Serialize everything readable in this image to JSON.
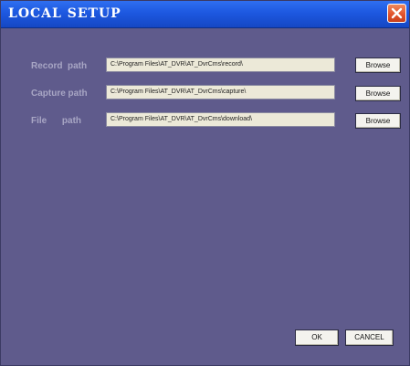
{
  "window": {
    "title": "LOCAL SETUP"
  },
  "paths": [
    {
      "label": "Record  path",
      "value": "C:\\Program Files\\AT_DVR\\AT_DvrCms\\record\\",
      "browse_label": "Browse"
    },
    {
      "label": "Capture path",
      "value": "C:\\Program Files\\AT_DVR\\AT_DvrCms\\capture\\",
      "browse_label": "Browse"
    },
    {
      "label": "File      path",
      "value": "C:\\Program Files\\AT_DVR\\AT_DvrCms\\download\\",
      "browse_label": "Browse"
    }
  ],
  "footer": {
    "ok_label": "OK",
    "cancel_label": "CANCEL"
  },
  "icons": {
    "close": "close-icon"
  },
  "colors": {
    "titlebar": "#1d58e0",
    "background": "#5f5b8c",
    "label": "#a8a6c4",
    "field": "#ece9d8",
    "close": "#e0502a"
  }
}
